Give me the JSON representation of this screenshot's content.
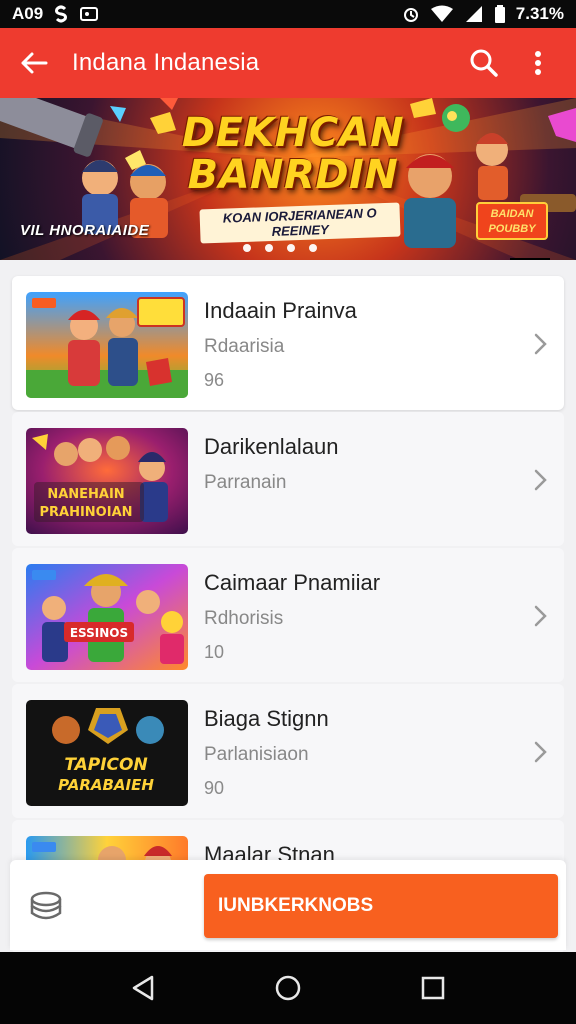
{
  "status_bar": {
    "left_text": "A09",
    "battery_text": "7.31%",
    "icons": [
      "notification-s-icon",
      "media-icon",
      "alarm-icon",
      "wifi-icon",
      "signal-icon",
      "battery-icon"
    ]
  },
  "app_bar": {
    "title": "Indana Indanesia",
    "icons": [
      "back-arrow-icon",
      "search-icon",
      "more-vert-icon"
    ],
    "color": "#ee3b2f"
  },
  "banner": {
    "title": "DEKHCAN BANRDIN",
    "subtitle": "KOAN IORJERIANEAN O REEINEY",
    "left_label": "VIL HNORAIAIDE",
    "badge": "BAIDAN POUBBY",
    "slide_count": 4
  },
  "items": [
    {
      "title": "Indaain Prainva",
      "subtitle": "Rdaarisia",
      "count": "96"
    },
    {
      "title": "Darikenlalaun",
      "subtitle": "Parranain",
      "count": ""
    },
    {
      "title": "Caimaar Pnamiiar",
      "subtitle": "Rdhorisis",
      "count": "10"
    },
    {
      "title": "Biaga Stignn",
      "subtitle": "Parlanisiaon",
      "count": "90"
    },
    {
      "title": "Maalar Stnan",
      "subtitle": "",
      "count": ""
    }
  ],
  "thumb_texts": {
    "item1": "",
    "item2": "NANEHAIN PRAHINOIAN",
    "item3": "ESSINOS",
    "item4": "TAPICON PARABAIEH"
  },
  "bottom": {
    "cta_label": "IUNBKERKNOBS",
    "cta_color": "#f8601f"
  },
  "nav_bar": {
    "icons": [
      "back-triangle-icon",
      "home-circle-icon",
      "recents-square-icon"
    ]
  }
}
